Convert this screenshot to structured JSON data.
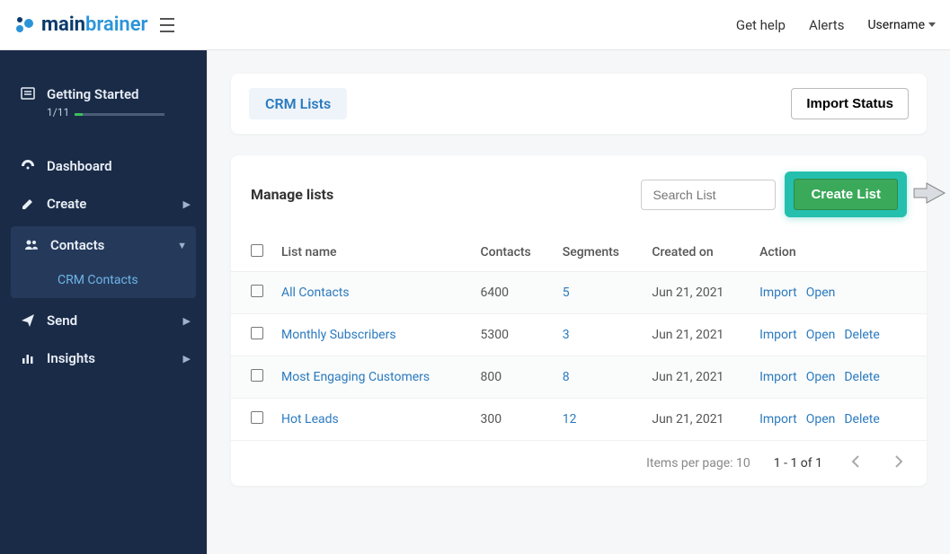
{
  "topbar": {
    "brand_heavy": "main",
    "brand_light": "brainer",
    "get_help": "Get help",
    "alerts": "Alerts",
    "username": "Username"
  },
  "sidebar": {
    "getting_started": {
      "label": "Getting Started",
      "progress_text": "1/11",
      "progress_pct": 9
    },
    "dashboard": "Dashboard",
    "create": "Create",
    "contacts": "Contacts",
    "crm_contacts": "CRM Contacts",
    "send": "Send",
    "insights": "Insights"
  },
  "header_card": {
    "crm_lists_tab": "CRM Lists",
    "import_status_btn": "Import Status"
  },
  "manage": {
    "title": "Manage lists",
    "search_placeholder": "Search List",
    "create_btn": "Create List"
  },
  "table": {
    "headers": {
      "name": "List name",
      "contacts": "Contacts",
      "segments": "Segments",
      "created": "Created on",
      "action": "Action"
    },
    "rows": [
      {
        "name": "All Contacts",
        "contacts": "6400",
        "segments": "5",
        "created": "Jun 21, 2021",
        "actions": [
          "Import",
          "Open"
        ]
      },
      {
        "name": "Monthly Subscribers",
        "contacts": "5300",
        "segments": "3",
        "created": "Jun 21, 2021",
        "actions": [
          "Import",
          "Open",
          "Delete"
        ]
      },
      {
        "name": "Most Engaging Customers",
        "contacts": "800",
        "segments": "8",
        "created": "Jun 21, 2021",
        "actions": [
          "Import",
          "Open",
          "Delete"
        ]
      },
      {
        "name": "Hot Leads",
        "contacts": "300",
        "segments": "12",
        "created": "Jun 21, 2021",
        "actions": [
          "Import",
          "Open",
          "Delete"
        ]
      }
    ],
    "items_per_page": "Items per page: 10",
    "range": "1 - 1 of 1"
  }
}
